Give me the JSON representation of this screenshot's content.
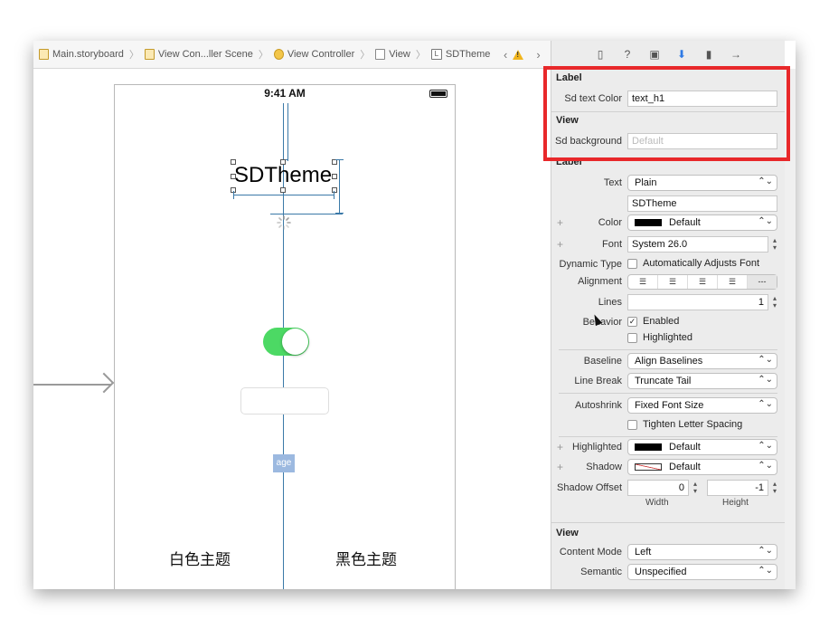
{
  "breadcrumb": {
    "items": [
      "Main.storyboard",
      "View Con...ller Scene",
      "View Controller",
      "View",
      "SDTheme"
    ]
  },
  "device": {
    "time": "9:41 AM",
    "theme_label": "SDTheme",
    "image_placeholder": "age",
    "toggle_on": true,
    "white_theme": "白色主题",
    "black_theme": "黑色主题"
  },
  "inspector": {
    "tab_icons": [
      "file-icon",
      "help-icon",
      "identity-icon",
      "attributes-icon",
      "size-icon",
      "connections-icon"
    ],
    "custom": {
      "label_section": "Label",
      "sd_text_color_label": "Sd text Color",
      "sd_text_color_value": "text_h1",
      "view_section": "View",
      "sd_background_label": "Sd background",
      "sd_background_placeholder": "Default"
    },
    "label": {
      "section": "Label",
      "text_label": "Text",
      "text_type": "Plain",
      "text_value": "SDTheme",
      "color_label": "Color",
      "color_value": "Default",
      "font_label": "Font",
      "font_value": "System 26.0",
      "dynamic_type_label": "Dynamic Type",
      "auto_adjust_label": "Automatically Adjusts Font",
      "alignment_label": "Alignment",
      "lines_label": "Lines",
      "lines_value": "1",
      "behavior_label": "Behavior",
      "enabled_label": "Enabled",
      "highlighted_check_label": "Highlighted",
      "baseline_label": "Baseline",
      "baseline_value": "Align Baselines",
      "line_break_label": "Line Break",
      "line_break_value": "Truncate Tail",
      "autoshrink_label": "Autoshrink",
      "autoshrink_value": "Fixed Font Size",
      "tighten_label": "Tighten Letter Spacing",
      "highlighted_label": "Highlighted",
      "highlighted_value": "Default",
      "shadow_label": "Shadow",
      "shadow_value": "Default",
      "shadow_offset_label": "Shadow Offset",
      "shadow_width": "0",
      "shadow_height": "-1",
      "width_caption": "Width",
      "height_caption": "Height"
    },
    "view": {
      "section": "View",
      "content_mode_label": "Content Mode",
      "content_mode_value": "Left",
      "semantic_label": "Semantic",
      "semantic_value": "Unspecified"
    }
  },
  "colors": {
    "accent": "#2f7ae5",
    "highlight_box": "#e8282a",
    "toggle_green": "#4cd964",
    "guide_blue": "#3b79a8"
  }
}
